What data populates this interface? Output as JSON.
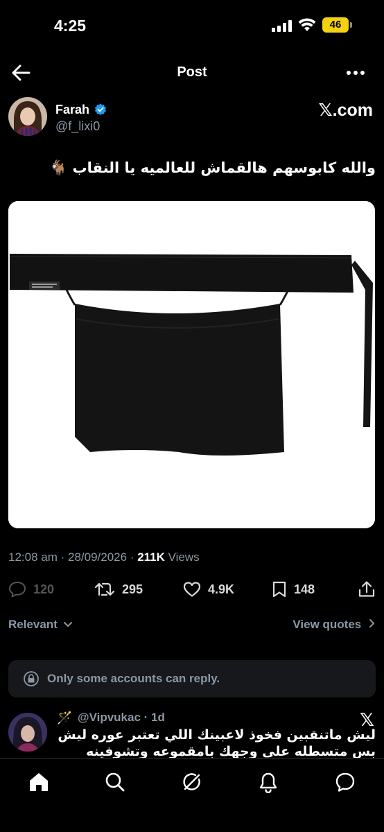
{
  "status_bar": {
    "time": "4:25",
    "battery": "46"
  },
  "header": {
    "title": "Post"
  },
  "author": {
    "name": "Farah",
    "handle": "@f_lixi0",
    "source": "𝕏.com"
  },
  "tweet": {
    "text": "والله كابوسهم هالقماش للعالميه يا النقاب 🐐",
    "time": "12:08 am",
    "date": "28/09/2026",
    "views_count": "211K",
    "views_label": "Views"
  },
  "actions": {
    "replies": "120",
    "reposts": "295",
    "likes": "4.9K",
    "bookmarks": "148"
  },
  "filters": {
    "sort": "Relevant",
    "view_quotes": "View quotes"
  },
  "reply_restriction": {
    "message": "Only some accounts can reply."
  },
  "reply": {
    "badge": "🪄",
    "user": "@Vipvukac · 1d",
    "source": "𝕏",
    "text": "ليش ماتنقبين فخوذ لاعبينك اللي تعتبر عوره ليش بس متسطله على وجهك بامقموعه وتشوفينه فضيحه بفشل"
  },
  "tabs": [
    "home",
    "search",
    "grok",
    "notifications",
    "messages"
  ]
}
